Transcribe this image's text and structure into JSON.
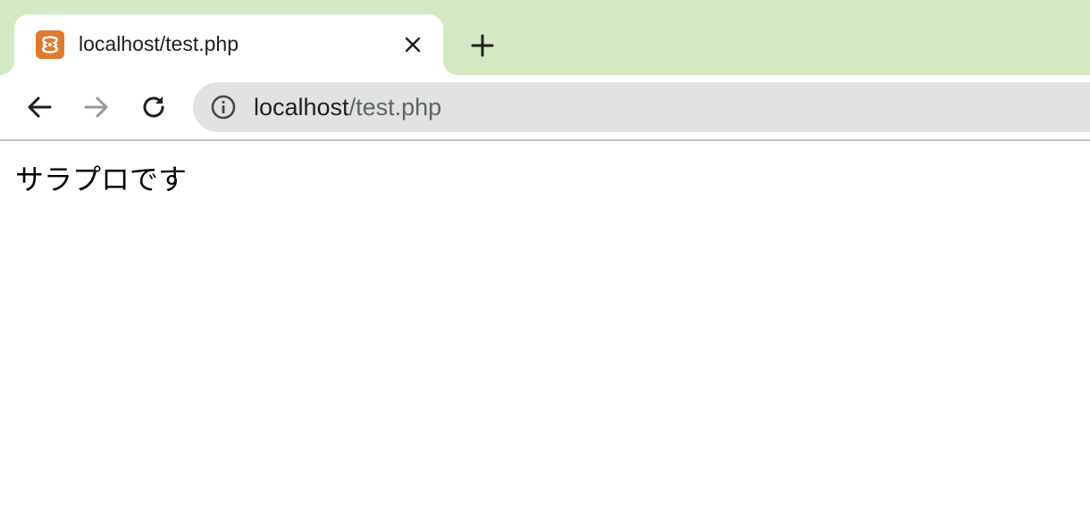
{
  "tab": {
    "title": "localhost/test.php",
    "favicon": "xampp-icon",
    "favicon_color": "#e07a2e"
  },
  "tabstrip": {
    "background": "#d3e9c3",
    "new_tab_icon": "plus-icon"
  },
  "toolbar": {
    "back_icon": "arrow-left-icon",
    "forward_icon": "arrow-right-icon",
    "reload_icon": "reload-icon"
  },
  "omnibox": {
    "info_icon": "info-icon",
    "url_host": "localhost",
    "url_path": "/test.php"
  },
  "page": {
    "text": "サラプロです"
  }
}
